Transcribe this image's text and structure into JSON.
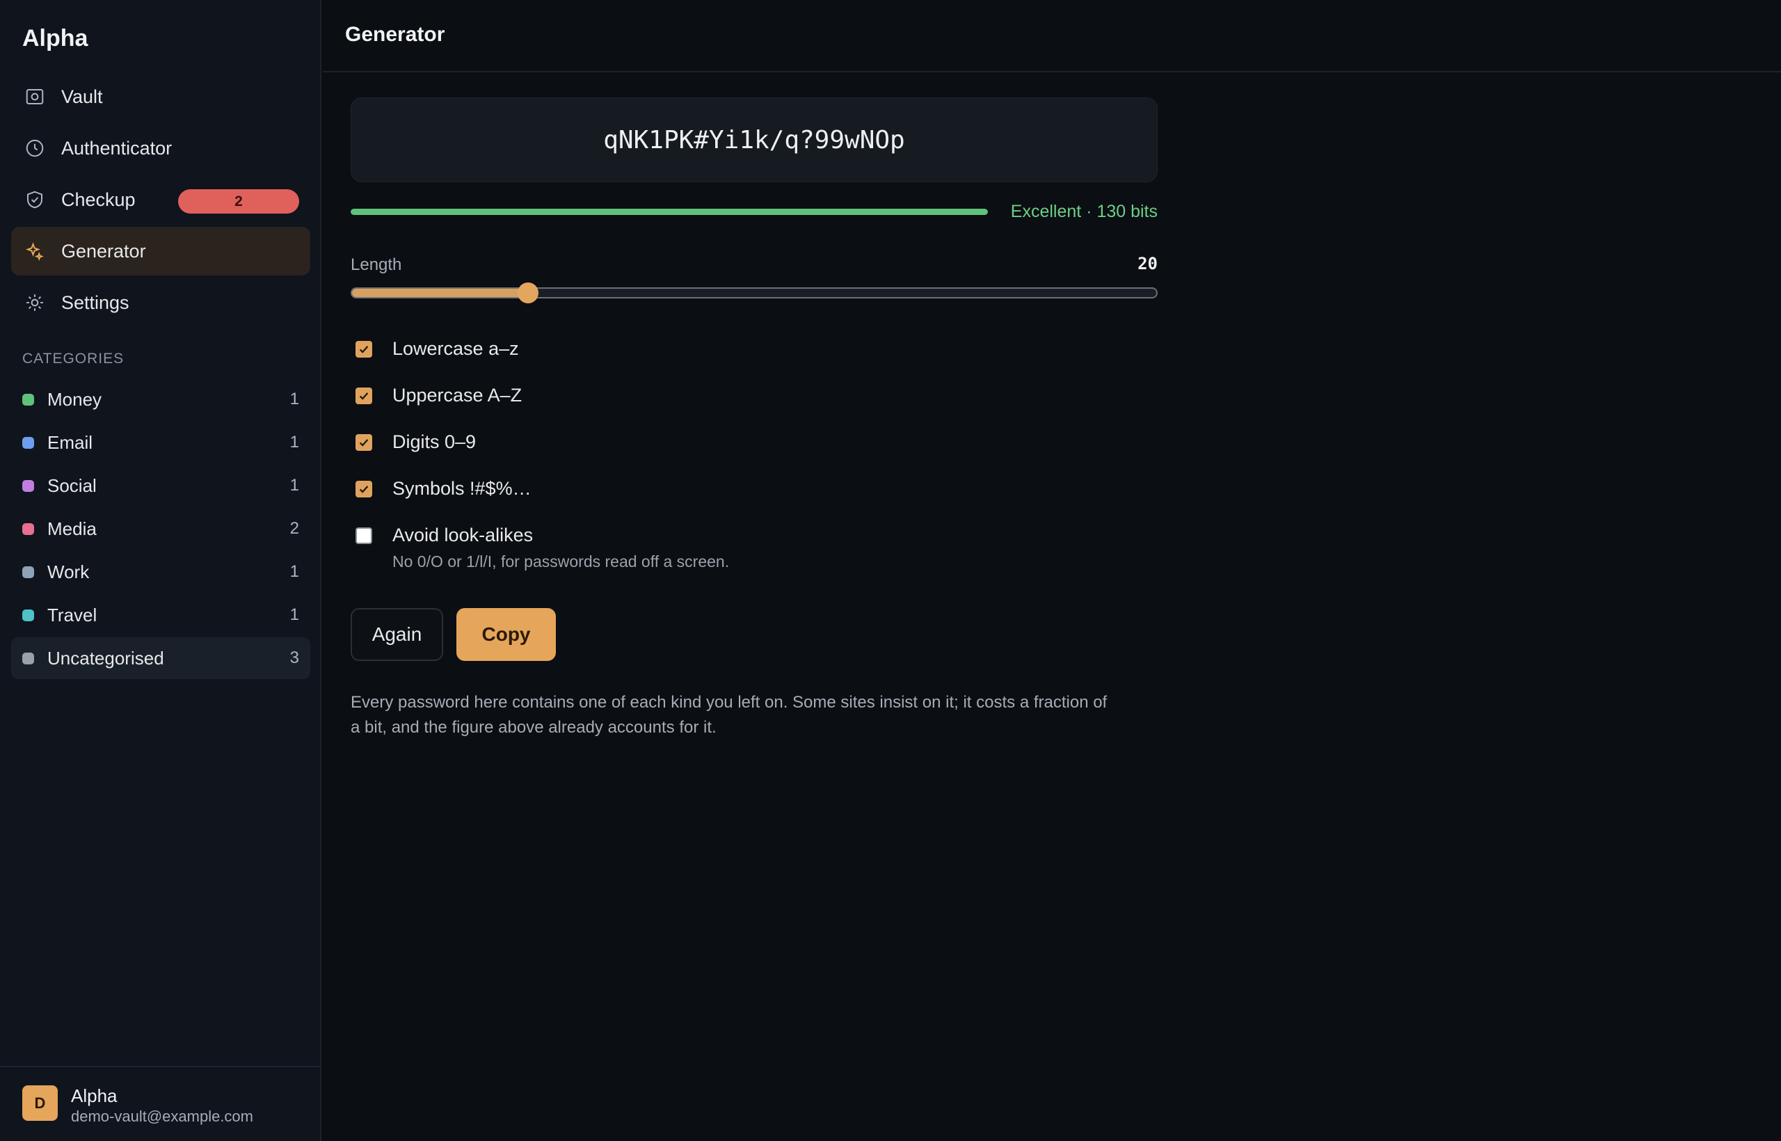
{
  "app": {
    "name": "Alpha"
  },
  "nav": [
    {
      "label": "Vault",
      "icon": "vault-icon"
    },
    {
      "label": "Authenticator",
      "icon": "clock-icon"
    },
    {
      "label": "Checkup",
      "icon": "shield-icon",
      "badge": "2"
    },
    {
      "label": "Generator",
      "icon": "sparkle-icon",
      "active": true
    },
    {
      "label": "Settings",
      "icon": "sun-icon"
    }
  ],
  "categories": {
    "title": "CATEGORIES",
    "items": [
      {
        "label": "Money",
        "count": "1",
        "color": "#5fc27a"
      },
      {
        "label": "Email",
        "count": "1",
        "color": "#6d9ef0"
      },
      {
        "label": "Social",
        "count": "1",
        "color": "#c07fe0"
      },
      {
        "label": "Media",
        "count": "2",
        "color": "#e86f8f"
      },
      {
        "label": "Work",
        "count": "1",
        "color": "#8fa3b8"
      },
      {
        "label": "Travel",
        "count": "1",
        "color": "#4fc1c9"
      },
      {
        "label": "Uncategorised",
        "count": "3",
        "color": "#9aa1aa"
      }
    ]
  },
  "user": {
    "initial": "D",
    "name": "Alpha",
    "email": "demo-vault@example.com"
  },
  "page": {
    "title": "Generator"
  },
  "generator": {
    "password": "qNK1PK#Yi1k/q?99wNOp",
    "strength_label": "Excellent · 130 bits",
    "strength_fraction": 1.0,
    "length_label": "Length",
    "length_value": "20",
    "length_fraction": 0.22,
    "options": [
      {
        "label": "Lowercase a–z",
        "checked": true
      },
      {
        "label": "Uppercase A–Z",
        "checked": true
      },
      {
        "label": "Digits 0–9",
        "checked": true
      },
      {
        "label": "Symbols !#$%…",
        "checked": true
      },
      {
        "label": "Avoid look-alikes",
        "checked": false,
        "hint": "No 0/O or 1/l/I, for passwords read off a screen."
      }
    ],
    "again_label": "Again",
    "copy_label": "Copy",
    "note": "Every password here contains one of each kind you left on. Some sites insist on it; it costs a fraction of a bit, and the figure above already accounts for it."
  },
  "colors": {
    "accent": "#e5a55a",
    "strength": "#5fc27a",
    "badge": "#e0615c"
  }
}
